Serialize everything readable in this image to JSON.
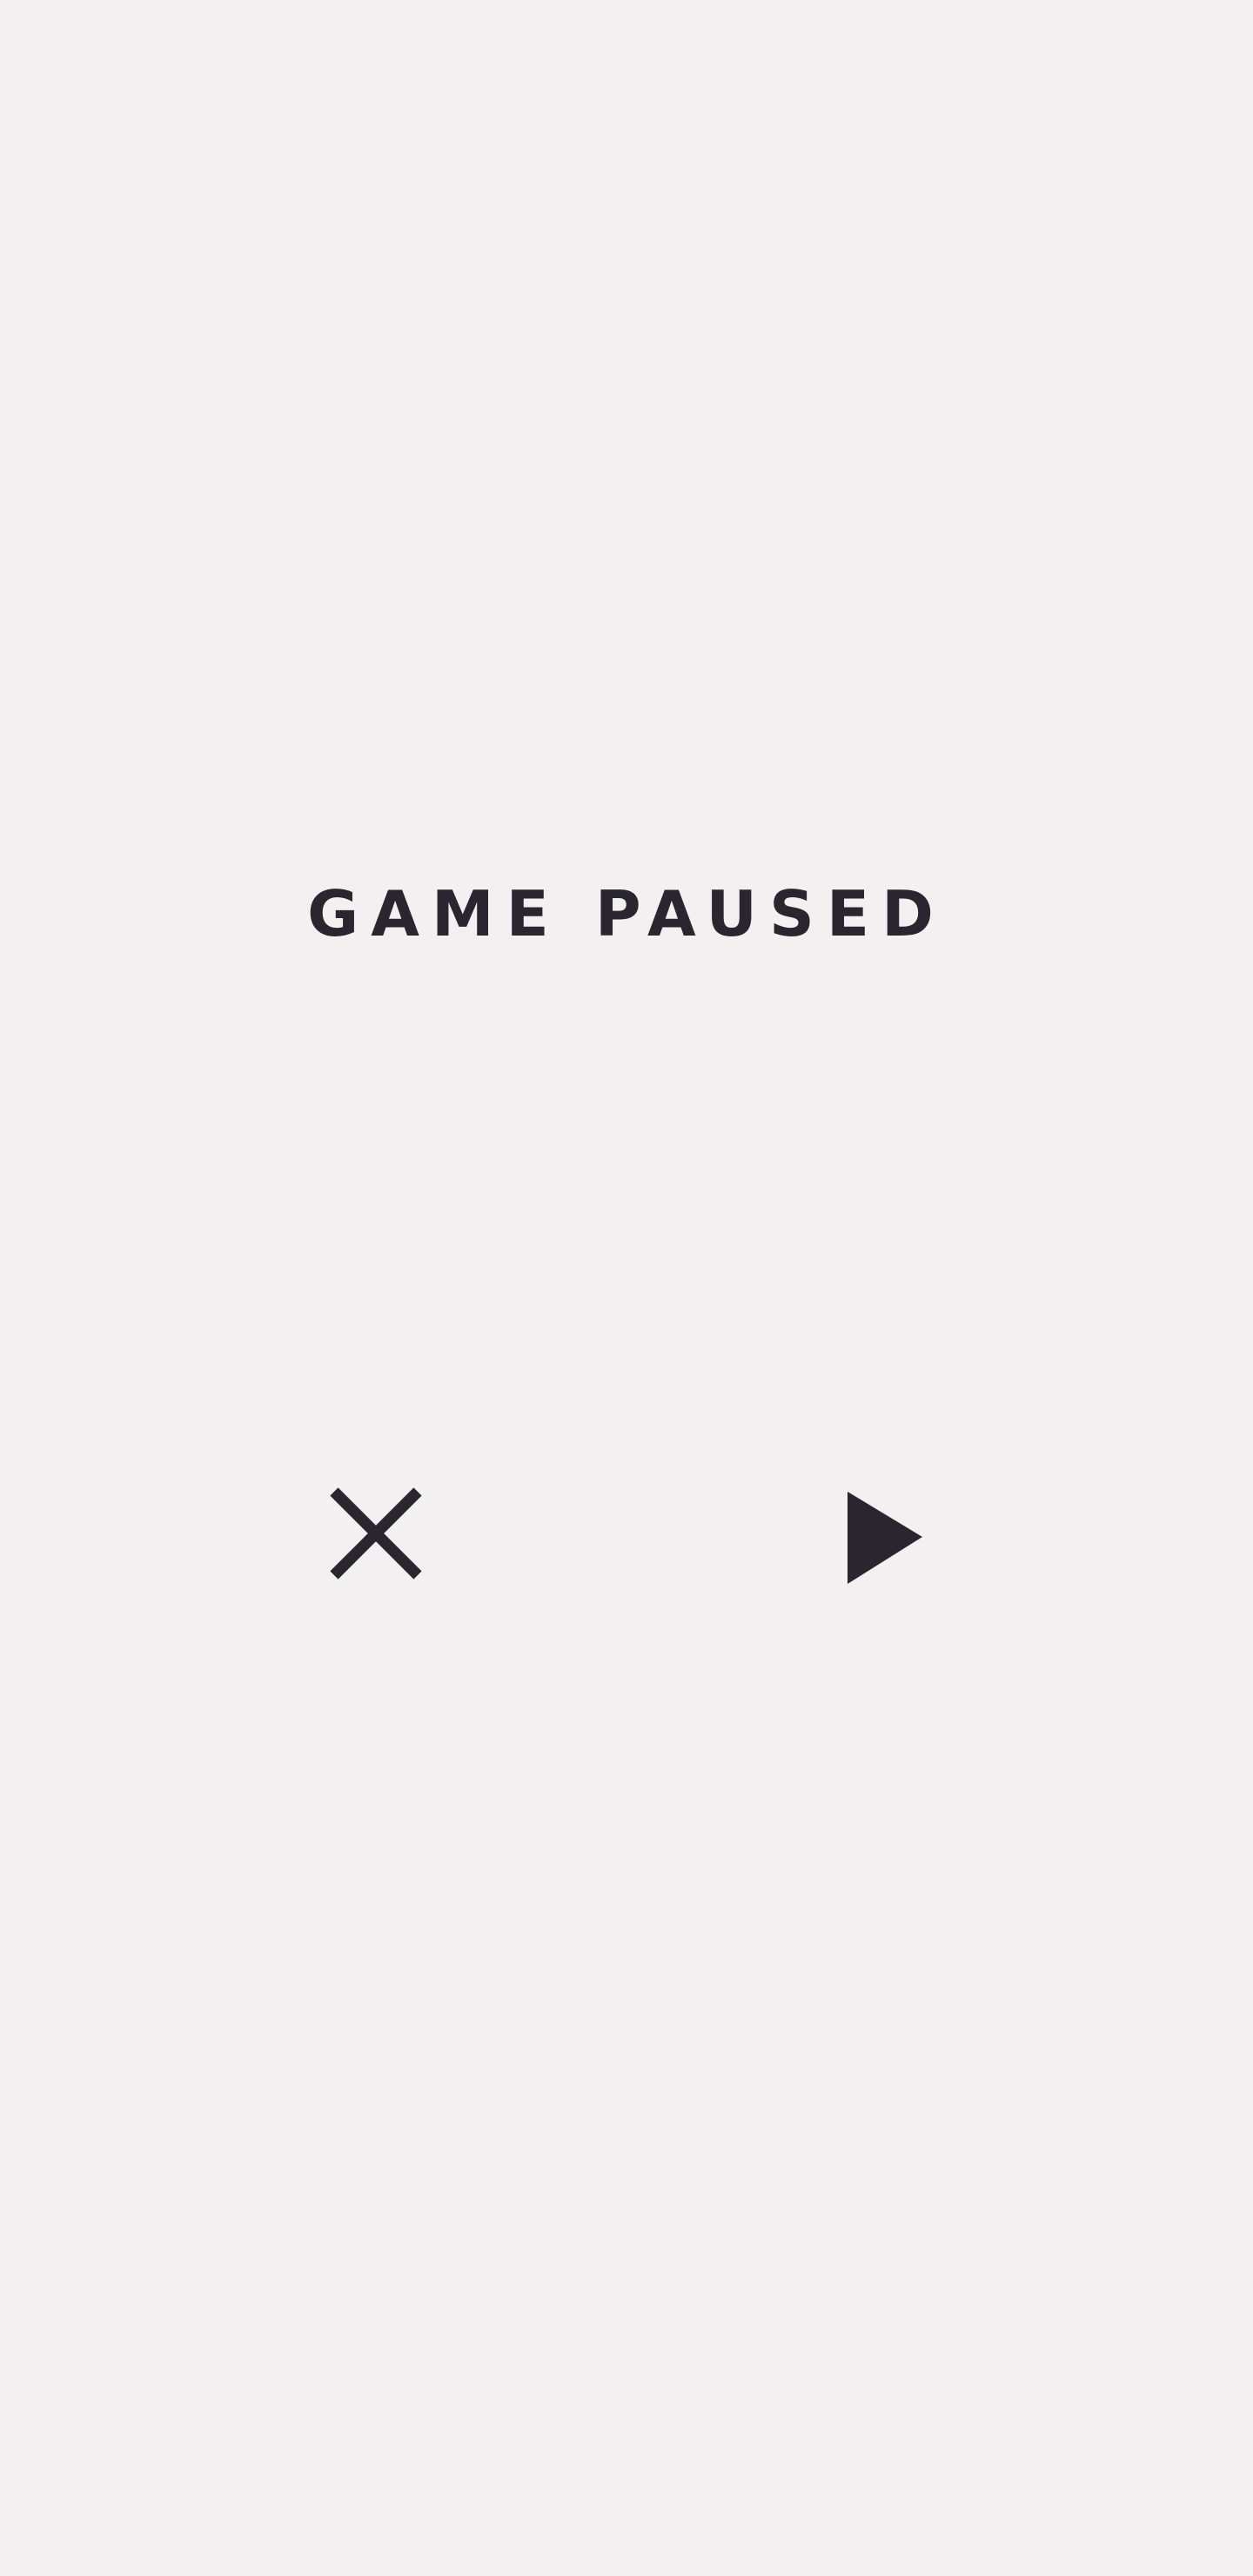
{
  "screen": {
    "title": "GAME PAUSED"
  },
  "controls": {
    "quit_icon": "close-icon",
    "resume_icon": "play-icon"
  },
  "colors": {
    "background": "#f2f0f1",
    "foreground": "#2a2630"
  }
}
